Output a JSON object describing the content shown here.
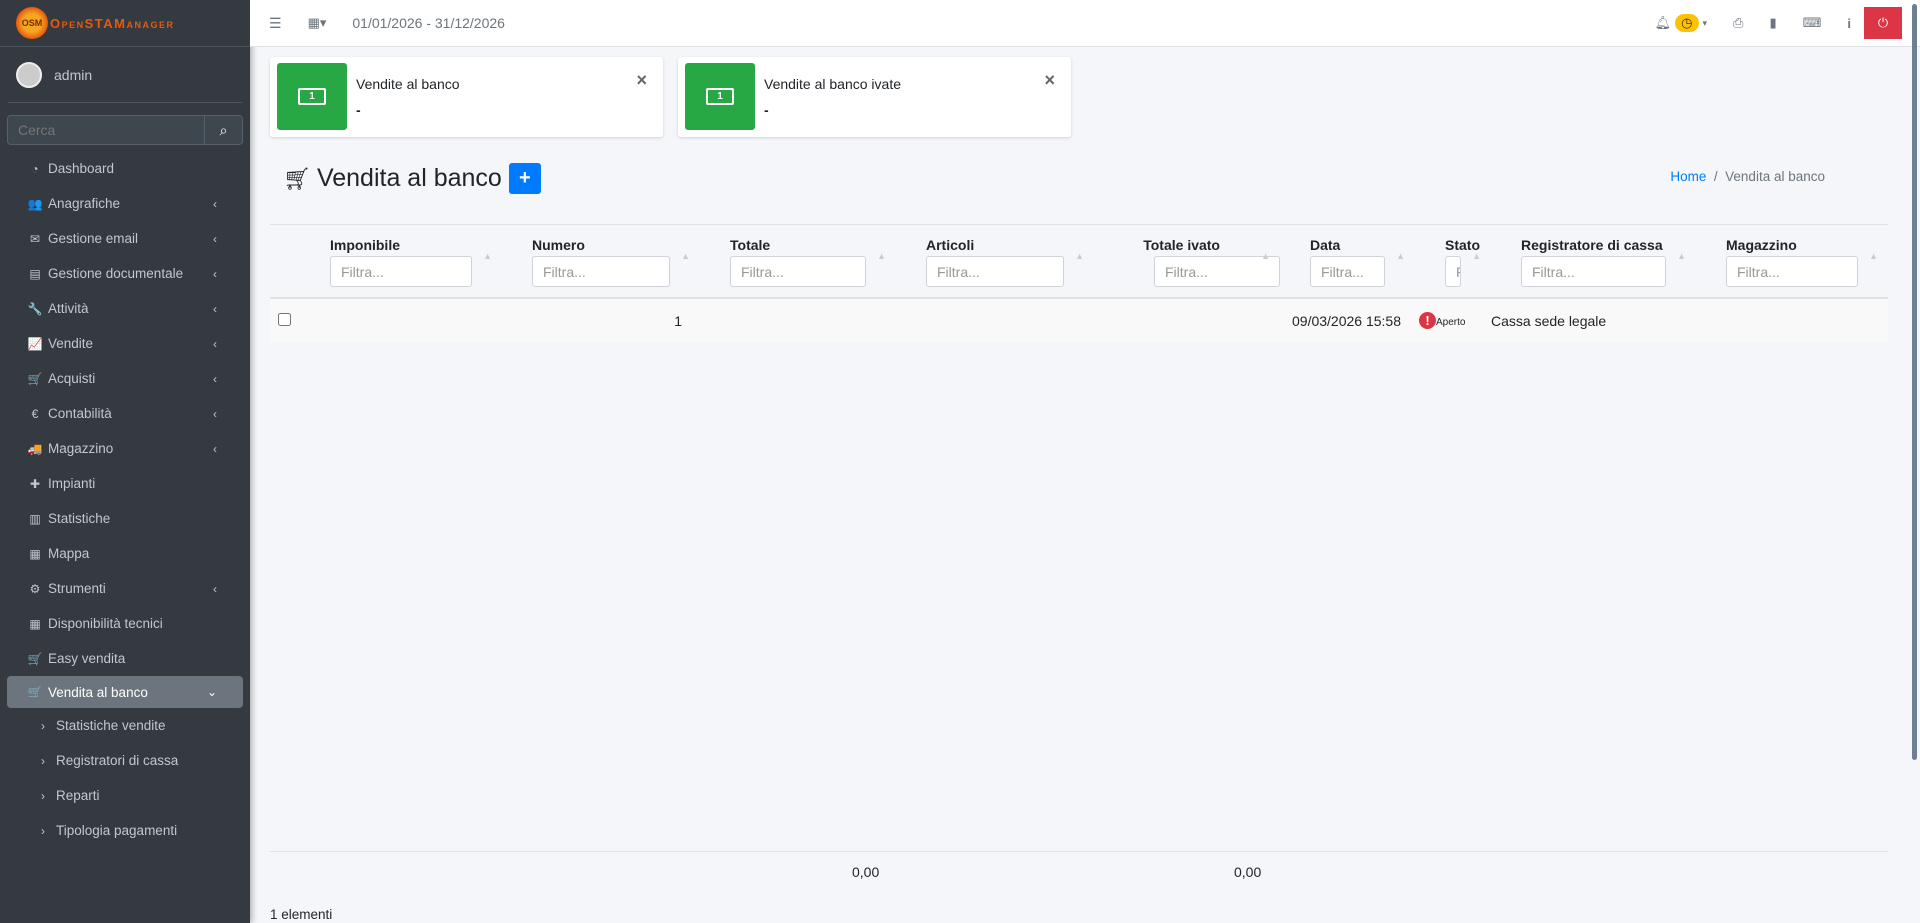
{
  "sidebar": {
    "logo": "OpenSTAManager",
    "user": "admin",
    "search_placeholder": "Cerca",
    "items": [
      {
        "label": "Dashboard",
        "icon": "dashboard-icon",
        "glyph": "◔"
      },
      {
        "label": "Anagrafiche",
        "icon": "users-icon",
        "glyph": "👥",
        "chev": true
      },
      {
        "label": "Gestione email",
        "icon": "envelope-icon",
        "glyph": "✉",
        "chev": true
      },
      {
        "label": "Gestione documentale",
        "icon": "file-icon",
        "glyph": "▤",
        "chev": true
      },
      {
        "label": "Attività",
        "icon": "wrench-icon",
        "glyph": "🔧",
        "chev": true
      },
      {
        "label": "Vendite",
        "icon": "line-chart-icon",
        "glyph": "📈",
        "chev": true
      },
      {
        "label": "Acquisti",
        "icon": "cart-icon",
        "glyph": "🛒",
        "chev": true
      },
      {
        "label": "Contabilità",
        "icon": "euro-icon",
        "glyph": "€",
        "chev": true
      },
      {
        "label": "Magazzino",
        "icon": "truck-icon",
        "glyph": "🚚",
        "chev": true
      },
      {
        "label": "Impianti",
        "icon": "puzzle-icon",
        "glyph": "✚"
      },
      {
        "label": "Statistiche",
        "icon": "bar-chart-icon",
        "glyph": "▥"
      },
      {
        "label": "Mappa",
        "icon": "map-icon",
        "glyph": "▦"
      },
      {
        "label": "Strumenti",
        "icon": "cog-icon",
        "glyph": "⚙",
        "chev": true
      },
      {
        "label": "Disponibilità tecnici",
        "icon": "calendar-icon",
        "glyph": "▦"
      },
      {
        "label": "Easy vendita",
        "icon": "cart-icon",
        "glyph": "🛒"
      },
      {
        "label": "Vendita al banco",
        "icon": "cart-icon",
        "glyph": "🛒",
        "chev": true,
        "active": true
      },
      {
        "label": "Statistiche vendite",
        "icon": "chevron-right-icon",
        "glyph": "›",
        "sub": true
      },
      {
        "label": "Registratori di cassa",
        "icon": "chevron-right-icon",
        "glyph": "›",
        "sub": true
      },
      {
        "label": "Reparti",
        "icon": "chevron-right-icon",
        "glyph": "›",
        "sub": true
      },
      {
        "label": "Tipologia pagamenti",
        "icon": "chevron-right-icon",
        "glyph": "›",
        "sub": true
      }
    ]
  },
  "topbar": {
    "period": "01/01/2026 - 31/12/2026"
  },
  "cards": [
    {
      "title": "Vendite al banco",
      "value": "-"
    },
    {
      "title": "Vendite al banco ivate",
      "value": "-"
    }
  ],
  "page": {
    "title": "Vendita al banco",
    "breadcrumb_home": "Home",
    "breadcrumb_current": "Vendita al banco"
  },
  "table": {
    "filter_placeholder": "Filtra...",
    "columns": [
      "Imponibile",
      "Numero",
      "Totale",
      "Articoli",
      "Totale ivato",
      "Data",
      "Stato",
      "Registratore di cassa",
      "Magazzino"
    ],
    "rows": [
      {
        "imponibile": "",
        "numero": "1",
        "totale": "",
        "articoli": "",
        "totale_ivato": "",
        "data": "09/03/2026 15:58",
        "stato": "Aperto",
        "registratore": "Cassa sede legale",
        "magazzino": ""
      }
    ],
    "totale_sum": "0,00",
    "totale_ivato_sum": "0,00",
    "count": "1 elementi"
  }
}
